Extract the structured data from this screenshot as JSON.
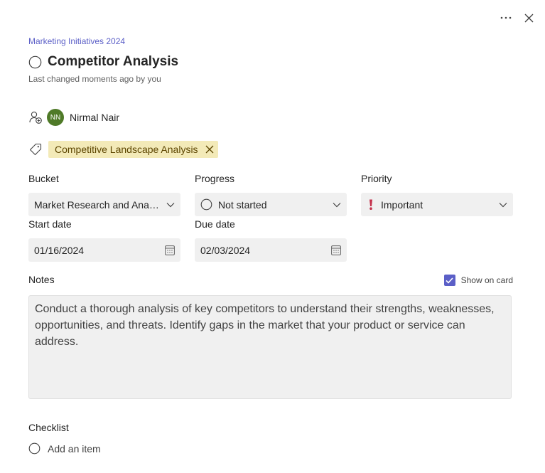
{
  "header": {
    "more_icon": "more-horizontal-icon",
    "close_icon": "close-icon"
  },
  "task": {
    "plan_name": "Marketing Initiatives 2024",
    "title": "Competitor Analysis",
    "last_changed": "Last changed moments ago by you"
  },
  "assignment": {
    "icon": "assign-user-icon",
    "avatar_initials": "NN",
    "assignee_name": "Nirmal Nair",
    "avatar_color": "#4f7a28"
  },
  "labels": {
    "icon": "tag-icon",
    "items": [
      {
        "text": "Competitive Landscape Analysis",
        "color": "#f3eab8"
      }
    ]
  },
  "fields": {
    "bucket": {
      "label": "Bucket",
      "value": "Market Research and Analysis"
    },
    "progress": {
      "label": "Progress",
      "value": "Not started"
    },
    "priority": {
      "label": "Priority",
      "value": "Important",
      "color": "#c4314b"
    },
    "start_date": {
      "label": "Start date",
      "value": "01/16/2024"
    },
    "due_date": {
      "label": "Due date",
      "value": "02/03/2024"
    }
  },
  "notes": {
    "label": "Notes",
    "show_on_card_label": "Show on card",
    "show_on_card_checked": true,
    "text": "Conduct a thorough analysis of key competitors to understand their strengths, weaknesses, opportunities, and threats. Identify gaps in the market that your product or service can address."
  },
  "checklist": {
    "label": "Checklist",
    "add_item_placeholder": "Add an item"
  },
  "colors": {
    "accent": "#5b5fc7",
    "field_bg": "#f0f0f0"
  }
}
